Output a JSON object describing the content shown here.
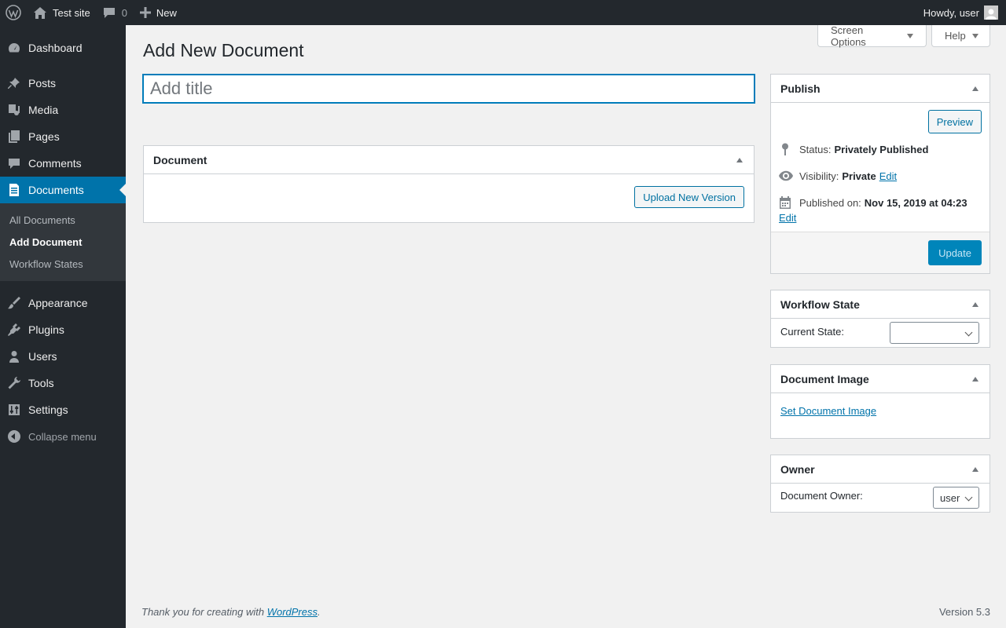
{
  "adminbar": {
    "site_name": "Test site",
    "comments_count": "0",
    "new_label": "New",
    "howdy": "Howdy, user"
  },
  "sidebar": {
    "items": [
      {
        "label": "Dashboard",
        "icon": "dashboard-icon"
      },
      {
        "label": "Posts",
        "icon": "pin-icon"
      },
      {
        "label": "Media",
        "icon": "media-icon"
      },
      {
        "label": "Pages",
        "icon": "pages-icon"
      },
      {
        "label": "Comments",
        "icon": "comment-icon"
      },
      {
        "label": "Documents",
        "icon": "document-icon"
      },
      {
        "label": "Appearance",
        "icon": "brush-icon"
      },
      {
        "label": "Plugins",
        "icon": "plug-icon"
      },
      {
        "label": "Users",
        "icon": "user-icon"
      },
      {
        "label": "Tools",
        "icon": "wrench-icon"
      },
      {
        "label": "Settings",
        "icon": "sliders-icon"
      }
    ],
    "submenu": [
      "All Documents",
      "Add Document",
      "Workflow States"
    ],
    "collapse_label": "Collapse menu"
  },
  "screen_options": "Screen Options",
  "help": "Help",
  "page_title": "Add New Document",
  "title_placeholder": "Add title",
  "document_box": {
    "title": "Document",
    "upload_button": "Upload New Version"
  },
  "publish": {
    "title": "Publish",
    "preview": "Preview",
    "status_label": "Status:",
    "status_value": "Privately Published",
    "visibility_label": "Visibility:",
    "visibility_value": "Private",
    "edit": "Edit",
    "published_label": "Published on:",
    "published_value": "Nov 15, 2019 at 04:23",
    "update": "Update"
  },
  "workflow": {
    "title": "Workflow State",
    "current_state_label": "Current State:",
    "current_state_value": ""
  },
  "document_image": {
    "title": "Document Image",
    "link": "Set Document Image"
  },
  "owner": {
    "title": "Owner",
    "label": "Document Owner:",
    "value": "user"
  },
  "footer": {
    "thanks_prefix": "Thank you for creating with ",
    "wp_link": "WordPress",
    "period": ".",
    "version": "Version 5.3"
  }
}
